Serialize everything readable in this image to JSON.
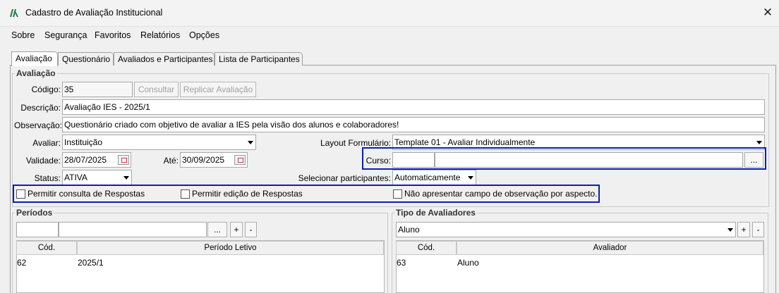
{
  "window": {
    "title": "Cadastro de Avaliação Institucional",
    "close_glyph": "✕"
  },
  "menu": [
    {
      "label": "Sobre"
    },
    {
      "label": "Segurança"
    },
    {
      "label": "Favoritos"
    },
    {
      "label": "Relatórios"
    },
    {
      "label": "Opções"
    }
  ],
  "tabs": [
    {
      "label": "Avaliação",
      "active": true
    },
    {
      "label": "Questionário"
    },
    {
      "label": "Avaliados e Participantes"
    },
    {
      "label": "Lista de Participantes"
    }
  ],
  "avaliacao": {
    "legend": "Avaliação",
    "codigo_label": "Código:",
    "codigo_value": "35",
    "consultar_label": "Consultar",
    "replicar_label": "Replicar Avaliação",
    "descricao_label": "Descrição:",
    "descricao_value": "Avaliação IES - 2025/1",
    "observacao_label": "Observação:",
    "observacao_value": "Questionário criado com objetivo de avaliar a IES pela visão dos alunos e colaboradores!",
    "avaliar_label": "Avaliar:",
    "avaliar_value": "Instituição",
    "layout_label": "Layout Formulário:",
    "layout_value": "Template 01 - Avaliar Individualmente",
    "validade_label": "Validade:",
    "validade_value": "28/07/2025",
    "ate_label": "Até:",
    "ate_value": "30/09/2025",
    "curso_label": "Curso:",
    "curso_code": "",
    "curso_name": "",
    "curso_btn": "...",
    "status_label": "Status:",
    "status_value": "ATIVA",
    "selecionar_label": "Selecionar participantes:",
    "selecionar_value": "Automaticamente",
    "chk_consulta": "Permitir consulta de Respostas",
    "chk_edicao": "Permitir edição de Respostas",
    "chk_observacao": "Não apresentar campo de observação por aspecto."
  },
  "periodos": {
    "legend": "Períodos",
    "btn_browse": "...",
    "btn_add": "+",
    "btn_remove": "-",
    "columns": [
      "Cód.",
      "Período Letivo"
    ],
    "rows": [
      {
        "cod": "62",
        "periodo": "2025/1"
      }
    ]
  },
  "tipo_avaliadores": {
    "legend": "Tipo de Avaliadores",
    "select_value": "Aluno",
    "btn_add": "+",
    "btn_remove": "-",
    "columns": [
      "Cód.",
      "Avaliador"
    ],
    "rows": [
      {
        "cod": "63",
        "avaliador": "Aluno"
      }
    ]
  },
  "colors": {
    "highlight": "#0a1fb8",
    "accent_icon": "#1a7a4a"
  }
}
